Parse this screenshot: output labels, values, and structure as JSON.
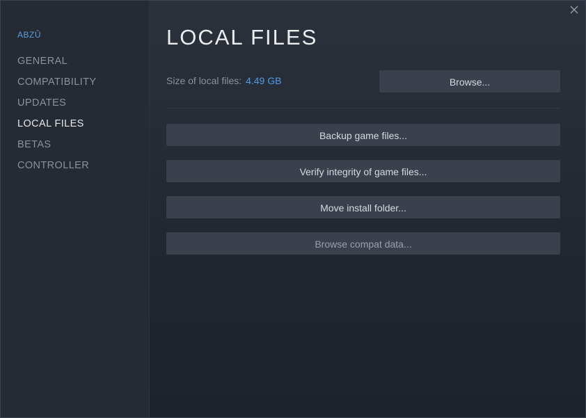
{
  "window": {
    "close_icon": "close-icon"
  },
  "sidebar": {
    "game_name": "ABZÛ",
    "items": [
      {
        "label": "GENERAL",
        "active": false
      },
      {
        "label": "COMPATIBILITY",
        "active": false
      },
      {
        "label": "UPDATES",
        "active": false
      },
      {
        "label": "LOCAL FILES",
        "active": true
      },
      {
        "label": "BETAS",
        "active": false
      },
      {
        "label": "CONTROLLER",
        "active": false
      }
    ]
  },
  "main": {
    "title": "LOCAL FILES",
    "size_label": "Size of local files:",
    "size_value": "4.49 GB",
    "browse_label": "Browse...",
    "actions": {
      "backup_label": "Backup game files...",
      "verify_label": "Verify integrity of game files...",
      "move_label": "Move install folder...",
      "compat_label": "Browse compat data..."
    }
  },
  "colors": {
    "accent": "#4f9ae8",
    "background": "#232830",
    "sidebar": "#252a33",
    "button": "#3a404c",
    "text_active": "#e6e9ed",
    "text_muted": "#8c929b"
  }
}
